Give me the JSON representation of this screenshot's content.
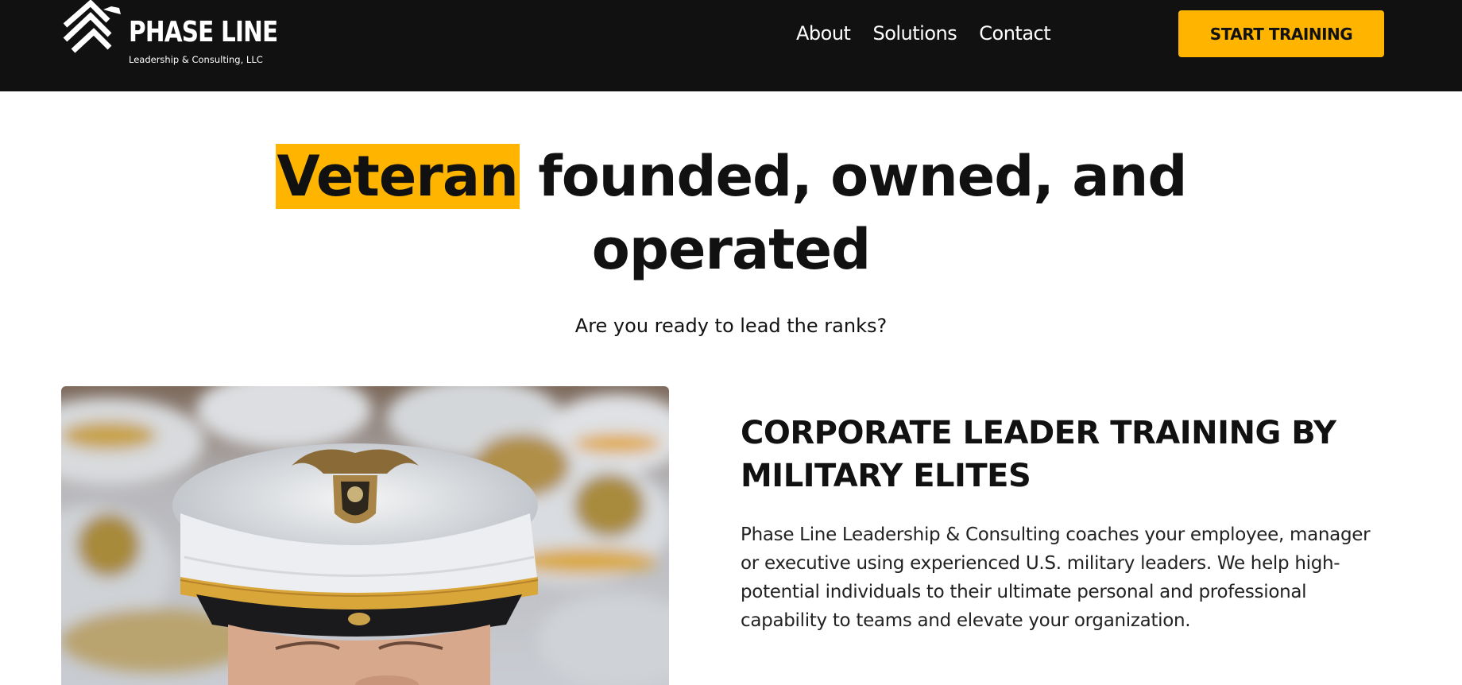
{
  "header": {
    "logo": {
      "name": "PHASE LINE",
      "tagline": "Leadership & Consulting, LLC"
    },
    "nav": [
      {
        "label": "About"
      },
      {
        "label": "Solutions"
      },
      {
        "label": "Contact"
      }
    ],
    "cta_label": "START TRAINING"
  },
  "hero": {
    "title_highlight": "Veteran",
    "title_rest": "founded, owned, and operated",
    "subtitle": "Are you ready to lead the ranks?"
  },
  "feature": {
    "title": "CORPORATE LEADER TRAINING BY MILITARY ELITES",
    "body": "Phase Line Leadership & Consulting coaches your employee, manager or executive using experienced U.S. military leaders. We help high-potential individuals to their ultimate personal and professional capability to teams and elevate your organization."
  },
  "colors": {
    "accent": "#ffb400",
    "header_bg": "#111111",
    "text": "#111111"
  },
  "icons": {
    "logo_mark": "chevron-stripes-eagle-logo"
  }
}
